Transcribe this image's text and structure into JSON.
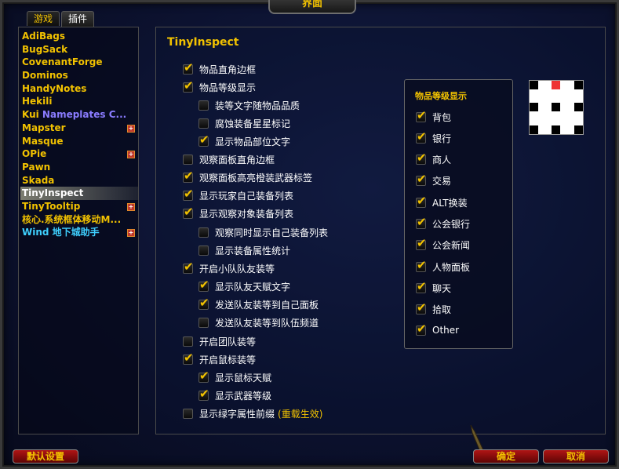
{
  "window": {
    "title": "界面"
  },
  "tabs": [
    {
      "label": "游戏",
      "active": false
    },
    {
      "label": "插件",
      "active": true
    }
  ],
  "addons": [
    {
      "label": "AdiBags"
    },
    {
      "label": "BugSack"
    },
    {
      "label": "CovenantForge"
    },
    {
      "label": "Dominos"
    },
    {
      "label": "HandyNotes"
    },
    {
      "label": "Hekili"
    },
    {
      "label_a": "Kui ",
      "label_b": "Nameplates C..."
    },
    {
      "label": "Mapster",
      "expand": "+"
    },
    {
      "label": "Masque"
    },
    {
      "label": "OPie",
      "expand": "+"
    },
    {
      "label": "Pawn"
    },
    {
      "label": "Skada"
    },
    {
      "label": "TinyInspect",
      "selected": true
    },
    {
      "label": "TinyTooltip",
      "expand": "+"
    },
    {
      "label": "核心.系统框体移动M...",
      "color": "cyan"
    },
    {
      "label_a": "Wind ",
      "label_b": "地下城助手",
      "expand": "+"
    }
  ],
  "main": {
    "title": "TinyInspect"
  },
  "options": [
    {
      "label": "物品直角边框",
      "checked": true
    },
    {
      "label": "物品等级显示",
      "checked": true
    },
    {
      "label": "装等文字随物品品质",
      "checked": false
    },
    {
      "label": "腐蚀装备星星标记",
      "checked": false
    },
    {
      "label": "显示物品部位文字",
      "checked": true
    },
    {
      "label": "观察面板直角边框",
      "checked": false
    },
    {
      "label": "观察面板高亮橙装武器标签",
      "checked": true
    },
    {
      "label": "显示玩家自己装备列表",
      "checked": true
    },
    {
      "label": "显示观察对象装备列表",
      "checked": true
    },
    {
      "label": "观察同时显示自己装备列表",
      "checked": false
    },
    {
      "label": "显示装备属性统计",
      "checked": false
    },
    {
      "label": "开启小队队友装等",
      "checked": true
    },
    {
      "label": "显示队友天赋文字",
      "checked": true
    },
    {
      "label": "发送队友装等到自己面板",
      "checked": true
    },
    {
      "label": "发送队友装等到队伍频道",
      "checked": false
    },
    {
      "label": "开启团队装等",
      "checked": false
    },
    {
      "label": "开启鼠标装等",
      "checked": true
    },
    {
      "label": "显示鼠标天赋",
      "checked": true
    },
    {
      "label": "显示武器等级",
      "checked": true
    },
    {
      "label": "显示绿字属性前缀",
      "checked": false,
      "note": "(重载生效)"
    }
  ],
  "item_level_box": {
    "title": "物品等级显示",
    "items": [
      {
        "label": "背包",
        "checked": true
      },
      {
        "label": "银行",
        "checked": true
      },
      {
        "label": "商人",
        "checked": true
      },
      {
        "label": "交易",
        "checked": true
      },
      {
        "label": "ALT换装",
        "checked": true
      },
      {
        "label": "公会银行",
        "checked": true
      },
      {
        "label": "公会新闻",
        "checked": true
      },
      {
        "label": "人物面板",
        "checked": true
      },
      {
        "label": "聊天",
        "checked": true
      },
      {
        "label": "拾取",
        "checked": true
      },
      {
        "label": "Other",
        "checked": true
      }
    ]
  },
  "anchor_selector": {
    "selected": "top"
  },
  "buttons": {
    "defaults": "默认设置",
    "ok": "确定",
    "cancel": "取消"
  },
  "colors": {
    "accent": "#f2c200",
    "button_red": "#b01515",
    "anchor_selected": "#e33333"
  }
}
